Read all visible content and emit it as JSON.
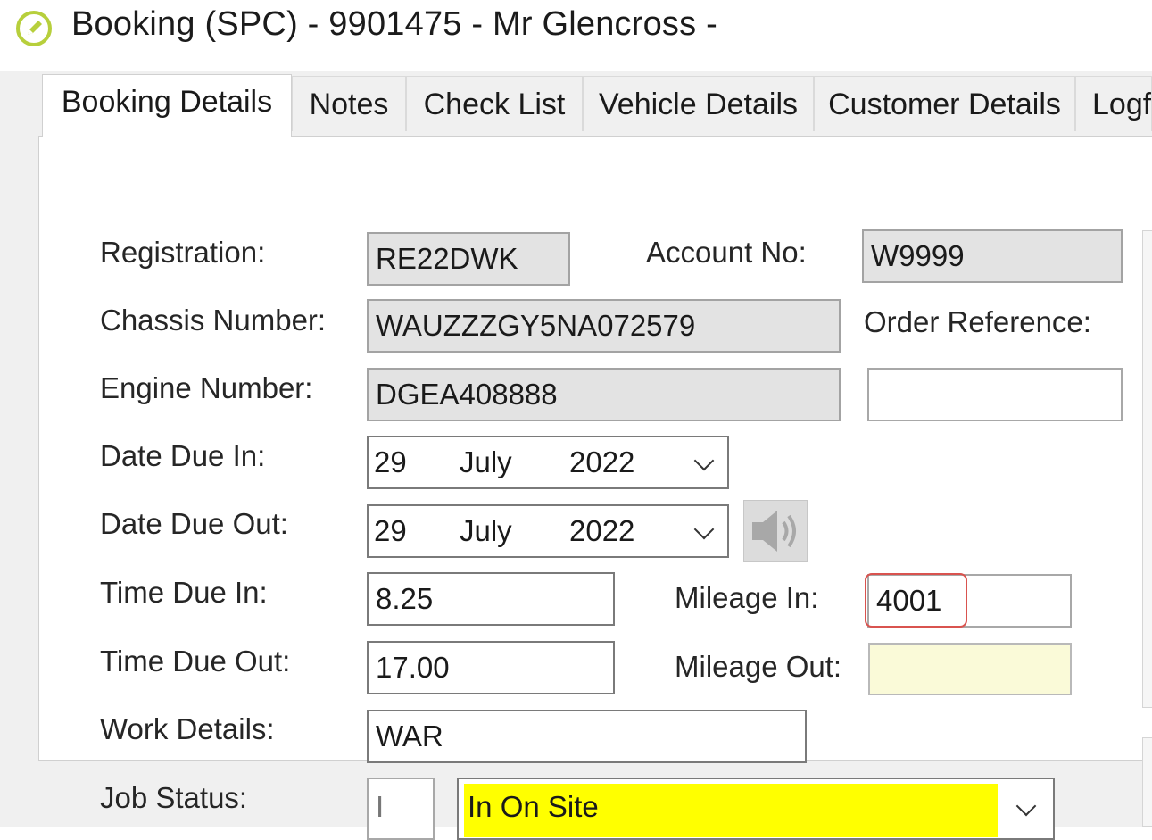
{
  "window": {
    "title": "Booking (SPC) - 9901475 - Mr Glencross -",
    "icon": "pencil-circle-icon",
    "accent_color": "#b7cf3c"
  },
  "tabs": [
    {
      "label": "Booking Details",
      "active": true
    },
    {
      "label": "Notes",
      "active": false
    },
    {
      "label": "Check List",
      "active": false
    },
    {
      "label": "Vehicle Details",
      "active": false
    },
    {
      "label": "Customer Details",
      "active": false
    },
    {
      "label": "Logf",
      "active": false
    }
  ],
  "form": {
    "registration_label": "Registration:",
    "registration_value": "RE22DWK",
    "account_no_label": "Account No:",
    "account_no_value": "W9999",
    "chassis_label": "Chassis Number:",
    "chassis_value": "WAUZZZGY5NA072579",
    "order_ref_label": "Order Reference:",
    "order_ref_value": "",
    "engine_label": "Engine Number:",
    "engine_value": "DGEA408888",
    "date_due_in_label": "Date Due In:",
    "date_due_in": {
      "day": "29",
      "month": "July",
      "year": "2022"
    },
    "date_due_out_label": "Date Due Out:",
    "date_due_out": {
      "day": "29",
      "month": "July",
      "year": "2022"
    },
    "sound_icon": "speaker-icon",
    "time_due_in_label": "Time Due In:",
    "time_due_in_value": "8.25",
    "mileage_in_label": "Mileage In:",
    "mileage_in_value": "4001",
    "time_due_out_label": "Time Due Out:",
    "time_due_out_value": "17.00",
    "mileage_out_label": "Mileage Out:",
    "mileage_out_value": "",
    "work_details_label": "Work Details:",
    "work_details_value": "WAR",
    "job_status_label": "Job Status:",
    "job_status_code": "I",
    "job_status_value": "In On Site",
    "job_status_color": "#ffff00",
    "mileage_out_color": "#fafad8",
    "highlight_color": "#d9534f"
  }
}
